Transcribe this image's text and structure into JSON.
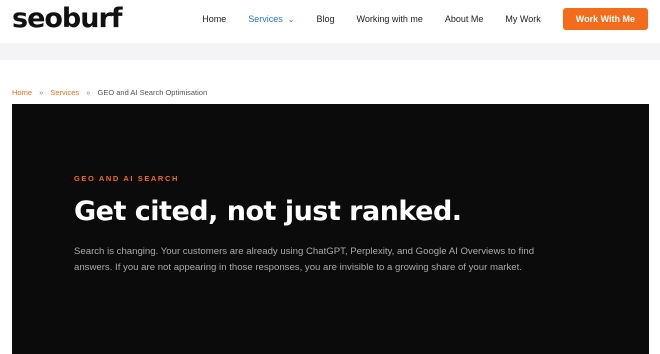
{
  "header": {
    "logo": "seoburf",
    "nav": [
      {
        "label": "Home"
      },
      {
        "label": "Services",
        "active": true,
        "has_dropdown": true,
        "icon": "chevron-down-icon"
      },
      {
        "label": "Blog"
      },
      {
        "label": "Working with me"
      },
      {
        "label": "About Me"
      },
      {
        "label": "My Work"
      }
    ],
    "cta_label": "Work With Me"
  },
  "breadcrumb": {
    "items": [
      "Home",
      "Services",
      "GEO and AI Search Optimisation"
    ],
    "separator": "»"
  },
  "hero": {
    "eyebrow": "GEO AND AI SEARCH",
    "headline": "Get cited, not just ranked.",
    "subtext": "Search is changing. Your customers are already using ChatGPT, Perplexity, and Google AI Overviews to find answers. If you are not appearing in those responses, you are invisible to a growing share of your market."
  },
  "colors": {
    "accent": "#f26c1b",
    "nav_active": "#2c74d6",
    "hero_bg": "#0b0b0c",
    "hero_text": "#ffffff",
    "hero_subtext": "#a9a9b0",
    "band": "#f4f4f6"
  }
}
